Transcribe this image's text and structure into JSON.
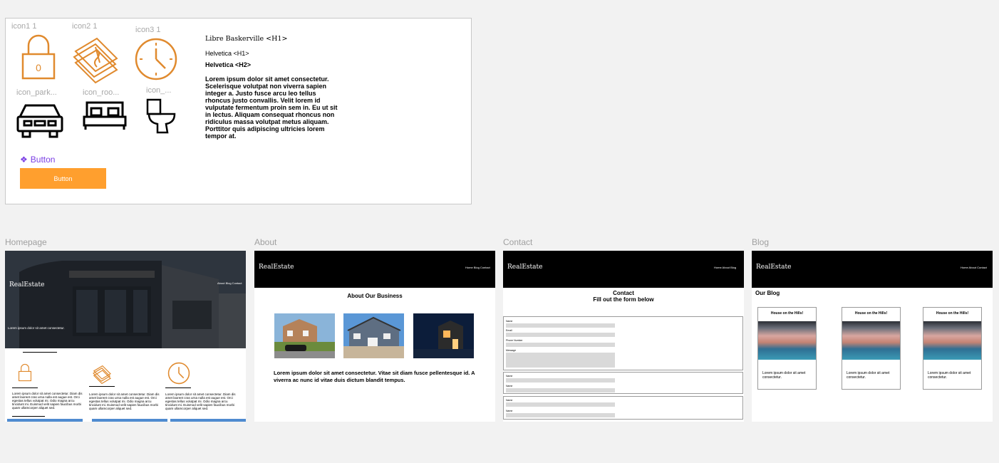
{
  "design_system": {
    "icons": [
      {
        "caption": "icon1 1",
        "icon": "lock-icon"
      },
      {
        "caption": "icon2 1",
        "icon": "money-stack-icon"
      },
      {
        "caption": "icon3 1",
        "icon": "clock-icon"
      },
      {
        "caption": "icon_park...",
        "icon": "car-icon"
      },
      {
        "caption": "icon_roo...",
        "icon": "bed-icon"
      },
      {
        "caption": "icon_...",
        "icon": "toilet-icon"
      }
    ],
    "typography": {
      "serif_h1": "Libre Baskerville <H1>",
      "sans_h1": "Helvetica <H1>",
      "sans_h2": "Helvetica <H2>",
      "body": "Lorem ipsum dolor sit amet consectetur. Scelerisque volutpat non viverra sapien integer a. Justo fusce arcu leo tellus rhoncus justo convallis. Velit lorem id vulputate fermentum proin sem in. Eu ut sit in lectus. Aliquam consequat rhoncus non ridiculus massa volutpat metus aliquam. Porttitor quis adipiscing ultricies lorem tempor at."
    },
    "component_label": "Button",
    "button_label": "Button",
    "accent_orange": "#ff9f2e",
    "icon_orange": "#e08a2e"
  },
  "frames": {
    "homepage_label": "Homepage",
    "about_label": "About",
    "contact_label": "Contact",
    "blog_label": "Blog"
  },
  "homepage": {
    "logo": "RealEstate",
    "nav": "About  Blog  Contact",
    "tagline": "Lorem ipsum dolor sit amet consectetur.",
    "features": [
      "Lorem ipsum dolor sit amet consectetur. Diam dis amet laoreet cras urna nulla est augue est. Orci egestas tellus volutpat mi. Odio magna arcu tincidunt mi. Euismod velit sapien faucibus morbi quam ullamcorper aliquet sed.",
      "Lorem ipsum dolor sit amet consectetur. Diam dis amet laoreet cras urna nulla est augue est. Orci egestas tellus volutpat mi. Odio magna arcu tincidunt mi. Euismod velit sapien faucibus morbi quam ullamcorper aliquet sed.",
      "Lorem ipsum dolor sit amet consectetur. Diam dis amet laoreet cras urna nulla est augue est. Orci egestas tellus volutpat mi. Odio magna arcu tincidunt mi. Euismod velit sapien faucibus morbi quam ullamcorper aliquet sed."
    ]
  },
  "about": {
    "logo": "RealEstate",
    "nav": "Home  Blog  Contact",
    "heading": "About Our Business",
    "body": "Lorem ipsum dolor sit amet consectetur. Vitae sit diam fusce pellentesque id. A viverra ac nunc id vitae duis dictum blandit tempus."
  },
  "contact": {
    "logo": "RealEstate",
    "nav": "Home  About  Blog",
    "heading": "Contact",
    "subheading": "Fill out the form below",
    "form1": [
      "Name",
      "Email",
      "Phone Number",
      "Message"
    ],
    "form2": [
      "Name",
      "Name"
    ],
    "form3": [
      "Name",
      "Name"
    ]
  },
  "blog": {
    "logo": "RealEstate",
    "nav": "Home  About  Contact",
    "heading": "Our Blog",
    "cards": [
      {
        "title": "House on the Hills!",
        "text": "Lorem ipsum dolor sit amet consectetur."
      },
      {
        "title": "House on the Hills!",
        "text": "Lorem ipsum dolor sit amet consectetur."
      },
      {
        "title": "House on the Hills!",
        "text": "Lorem ipsum dolor sit amet consectetur."
      }
    ]
  }
}
